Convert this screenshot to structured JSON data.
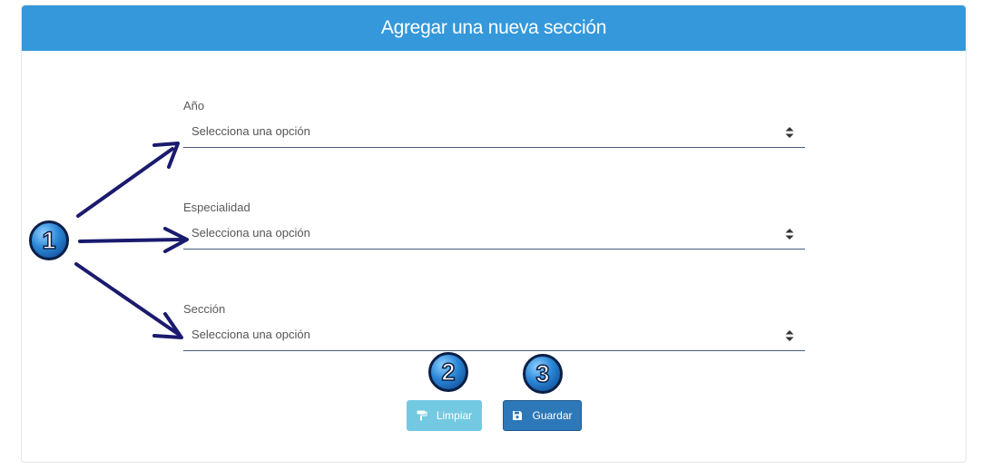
{
  "header": {
    "title": "Agregar una nueva sección"
  },
  "form": {
    "fields": [
      {
        "label": "Año",
        "value": "Selecciona una opción"
      },
      {
        "label": "Especialidad",
        "value": "Selecciona una opción"
      },
      {
        "label": "Sección",
        "value": "Selecciona una opción"
      }
    ]
  },
  "buttons": {
    "clear_label": "Limpiar",
    "save_label": "Guardar"
  },
  "callouts": [
    "1",
    "2",
    "3"
  ],
  "colors": {
    "header_bg": "#3498db",
    "clear_btn": "#5bc0de",
    "save_btn": "#2c78b9",
    "arrow": "#1a1a6e"
  }
}
